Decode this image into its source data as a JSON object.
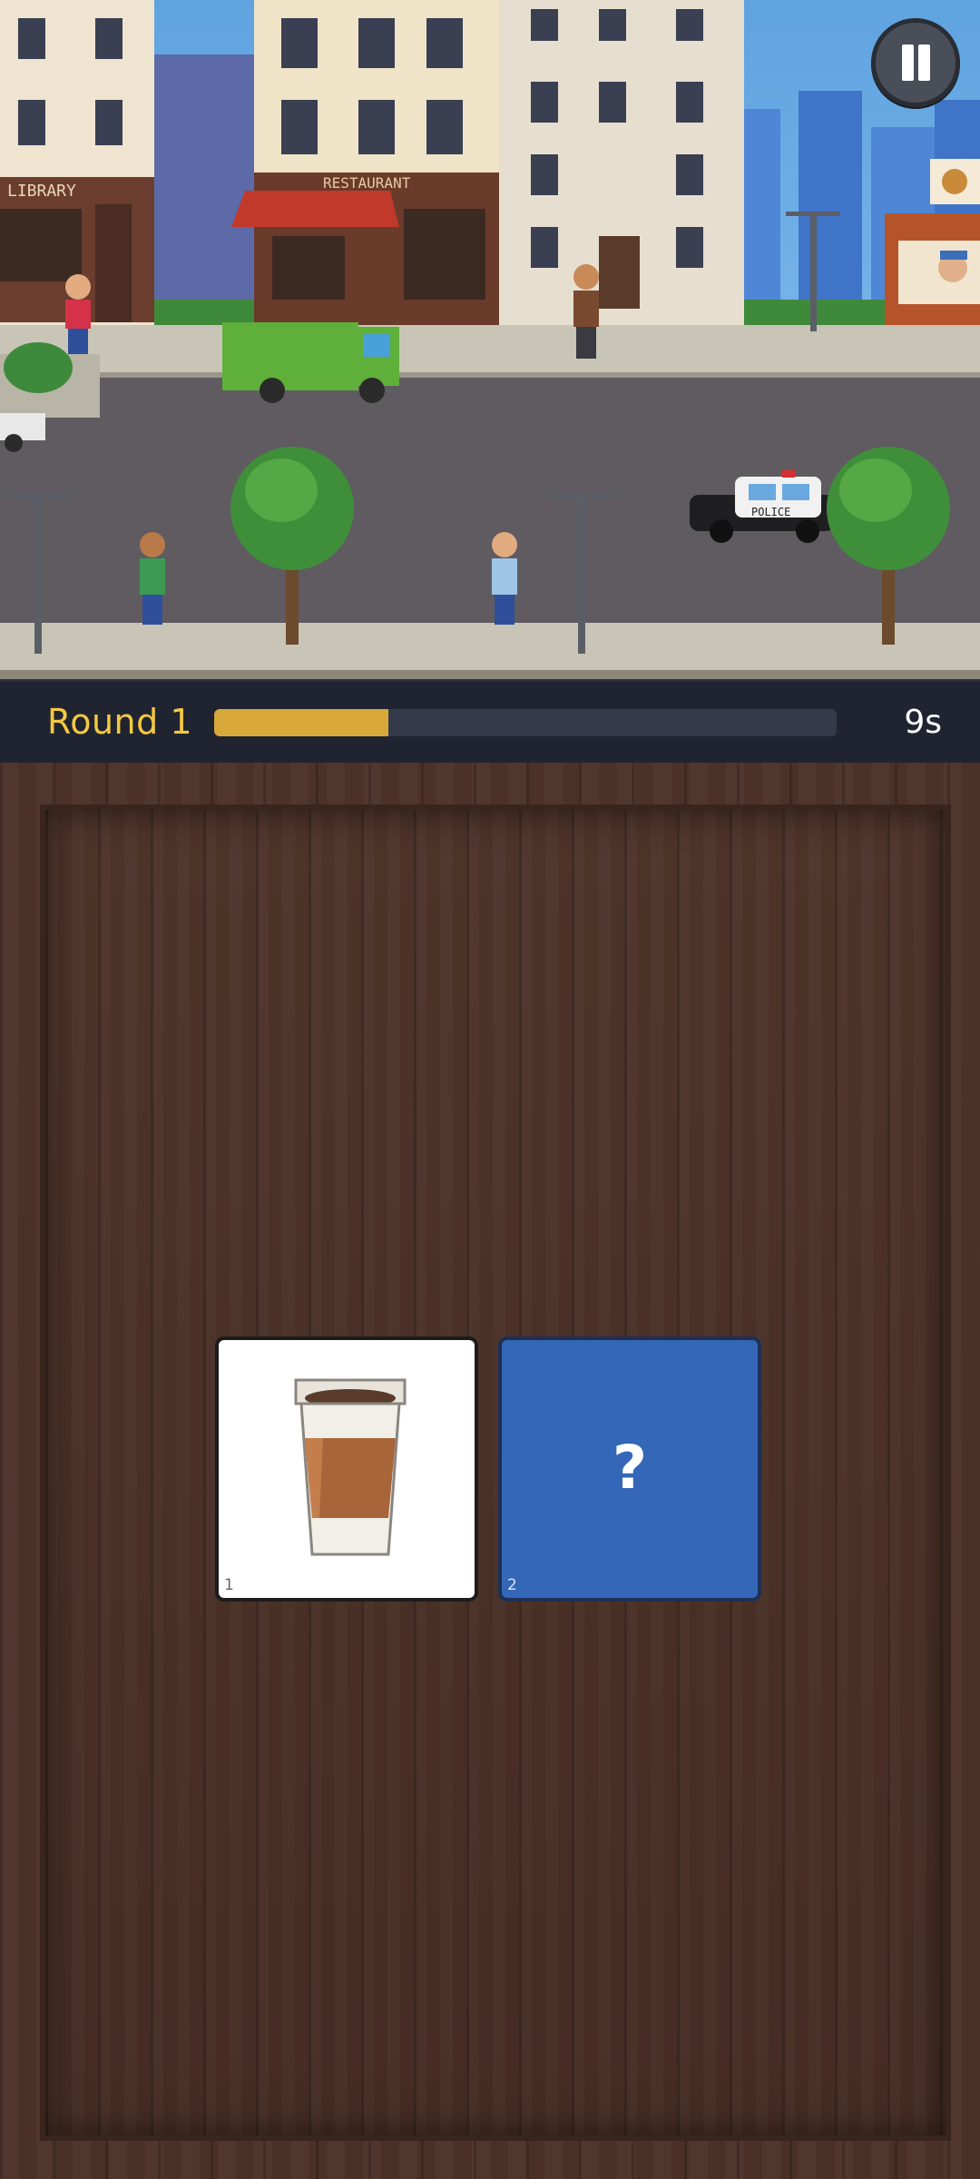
{
  "scene": {
    "signs": {
      "library": "LIBRARY",
      "restaurant": "RESTAURANT",
      "police": "POLICE"
    }
  },
  "hud": {
    "round_label": "Round 1",
    "progress_fraction": 0.28,
    "timer": "9s"
  },
  "cards": [
    {
      "number": "1",
      "face": "coffee-cup",
      "revealed": true
    },
    {
      "number": "2",
      "face": "?",
      "revealed": false
    }
  ],
  "colors": {
    "round_label": "#f4c842",
    "progress_fill": "#d8a93a",
    "hidden_card": "#3467b7"
  }
}
